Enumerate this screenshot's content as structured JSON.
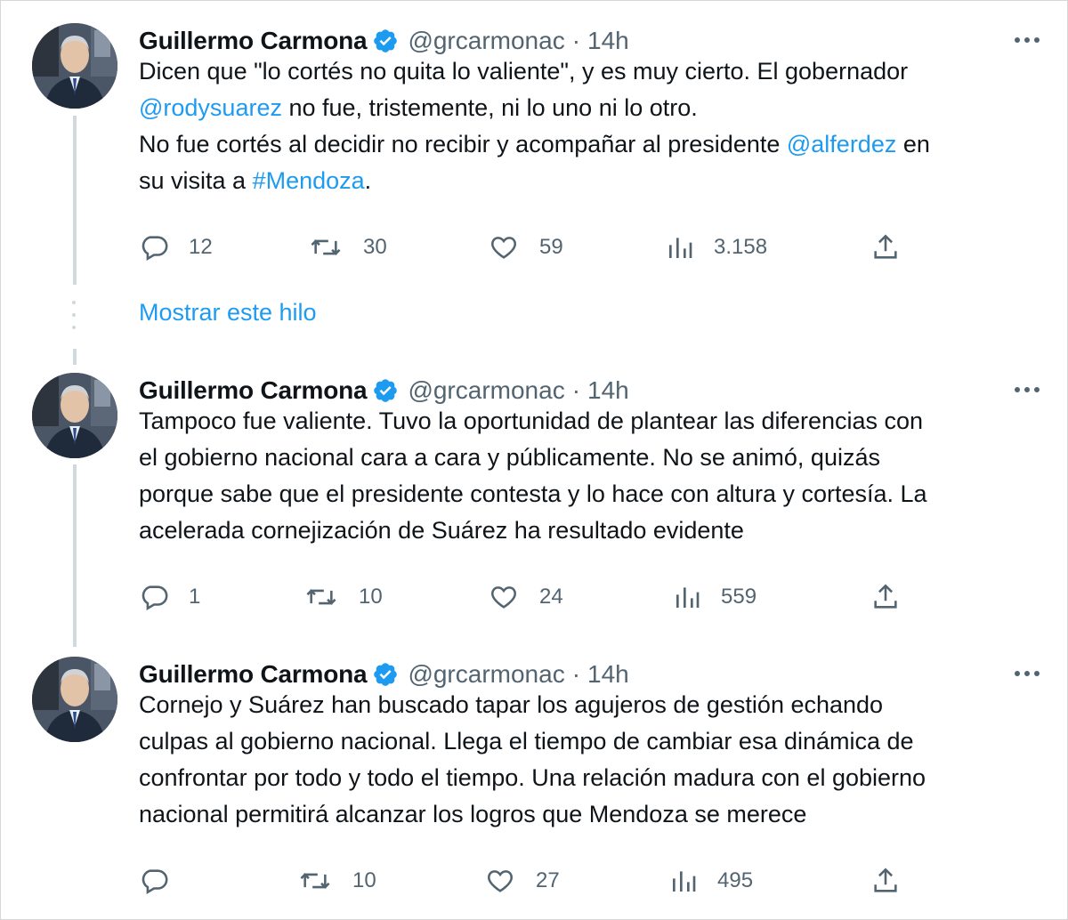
{
  "colors": {
    "link": "#1d9bf0",
    "text": "#0f1419",
    "muted": "#536471",
    "line": "#cfd9de"
  },
  "show_thread_label": "Mostrar este hilo",
  "tweets": [
    {
      "name": "Guillermo Carmona",
      "handle": "@grcarmonac",
      "separator": "·",
      "time": "14h",
      "lines": [
        [
          {
            "t": "Dicen que \"lo cortés no quita lo valiente\", y es muy cierto. El gobernador"
          }
        ],
        [
          {
            "t": "@rodysuarez",
            "link": true
          },
          {
            "t": " no fue, tristemente, ni lo uno ni lo otro."
          }
        ],
        [
          {
            "t": "No fue cortés al decidir no recibir y acompañar al presidente "
          },
          {
            "t": "@alferdez",
            "link": true
          },
          {
            "t": " en"
          }
        ],
        [
          {
            "t": "su visita a "
          },
          {
            "t": "#Mendoza",
            "link": true
          },
          {
            "t": "."
          }
        ]
      ],
      "stats": {
        "replies": "12",
        "retweets": "30",
        "likes": "59",
        "views": "3.158"
      }
    },
    {
      "name": "Guillermo Carmona",
      "handle": "@grcarmonac",
      "separator": "·",
      "time": "14h",
      "lines": [
        [
          {
            "t": "Tampoco fue valiente. Tuvo la oportunidad de plantear las diferencias con"
          }
        ],
        [
          {
            "t": "el gobierno nacional cara a cara y públicamente. No se animó, quizás"
          }
        ],
        [
          {
            "t": "porque sabe que el presidente contesta y lo hace con altura y cortesía. La"
          }
        ],
        [
          {
            "t": "acelerada cornejización de Suárez ha resultado evidente"
          }
        ]
      ],
      "stats": {
        "replies": "1",
        "retweets": "10",
        "likes": "24",
        "views": "559"
      }
    },
    {
      "name": "Guillermo Carmona",
      "handle": "@grcarmonac",
      "separator": "·",
      "time": "14h",
      "lines": [
        [
          {
            "t": "Cornejo y Suárez han buscado tapar los agujeros de gestión echando"
          }
        ],
        [
          {
            "t": "culpas al gobierno nacional. Llega el tiempo de cambiar esa dinámica de"
          }
        ],
        [
          {
            "t": "confrontar por todo y todo el tiempo. Una relación madura con el gobierno"
          }
        ],
        [
          {
            "t": "nacional permitirá alcanzar los logros que Mendoza se merece"
          }
        ]
      ],
      "stats": {
        "replies": "",
        "retweets": "10",
        "likes": "27",
        "views": "495"
      }
    }
  ]
}
